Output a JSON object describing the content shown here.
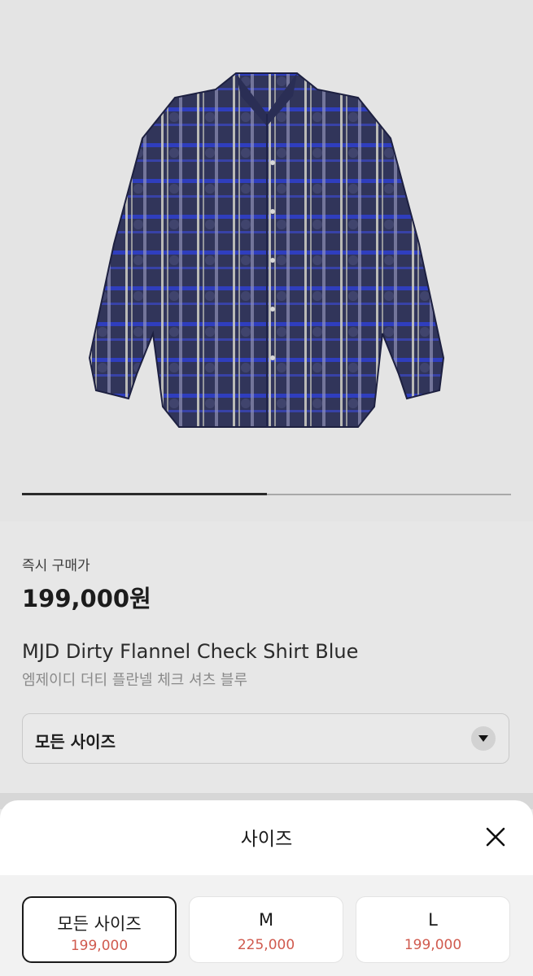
{
  "product": {
    "price_label": "즉시 구매가",
    "price": "199,000원",
    "name_en": "MJD Dirty Flannel Check Shirt Blue",
    "name_ko": "엠제이디 더티 플란넬 체크 셔츠 블루"
  },
  "gallery": {
    "progress": 0.5
  },
  "size_selector": {
    "label": "모든 사이즈"
  },
  "sheet": {
    "title": "사이즈",
    "options": [
      {
        "name": "모든 사이즈",
        "price": "199,000",
        "selected": true
      },
      {
        "name": "M",
        "price": "225,000",
        "selected": false
      },
      {
        "name": "L",
        "price": "199,000",
        "selected": false
      }
    ]
  },
  "colors": {
    "accent_price": "#d05a4e",
    "shirt_blue": "#2a2f7a"
  },
  "icons": {
    "close": "close-icon",
    "dropdown": "chevron-down-icon"
  }
}
